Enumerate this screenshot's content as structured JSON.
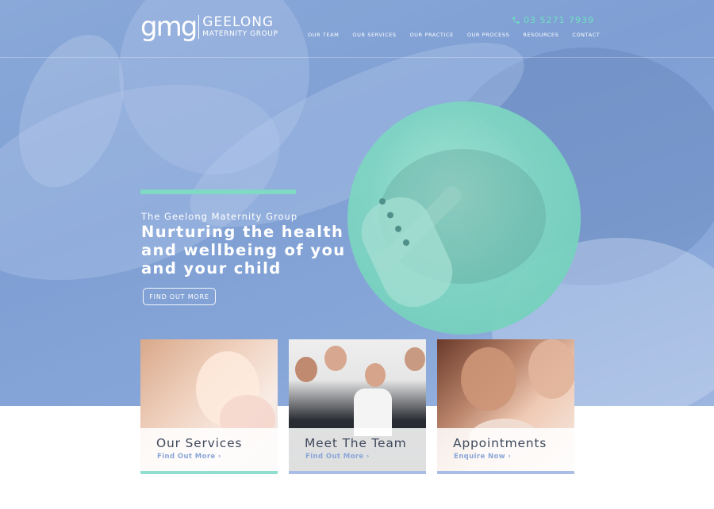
{
  "brand": {
    "mark": "gmg",
    "name_line1": "GEELONG",
    "name_line2": "MATERNITY GROUP"
  },
  "header": {
    "phone": "03 5271 7939",
    "nav": [
      "OUR TEAM",
      "OUR SERVICES",
      "OUR PRACTICE",
      "OUR PROCESS",
      "RESOURCES",
      "CONTACT"
    ]
  },
  "hero": {
    "kicker": "The Geelong Maternity Group",
    "headline": "Nurturing the health and wellbeing of you and your child",
    "cta": "FIND OUT MORE"
  },
  "cards": [
    {
      "title": "Our Services",
      "link": "Find Out More ›"
    },
    {
      "title": "Meet The Team",
      "link": "Find Out More ›"
    },
    {
      "title": "Appointments",
      "link": "Enquire Now ›"
    }
  ],
  "colors": {
    "hero_blue": "#86a6d8",
    "accent_teal": "#7fd9c4",
    "link_blue": "#8aa5d8",
    "card_title": "#3f4a5c"
  }
}
